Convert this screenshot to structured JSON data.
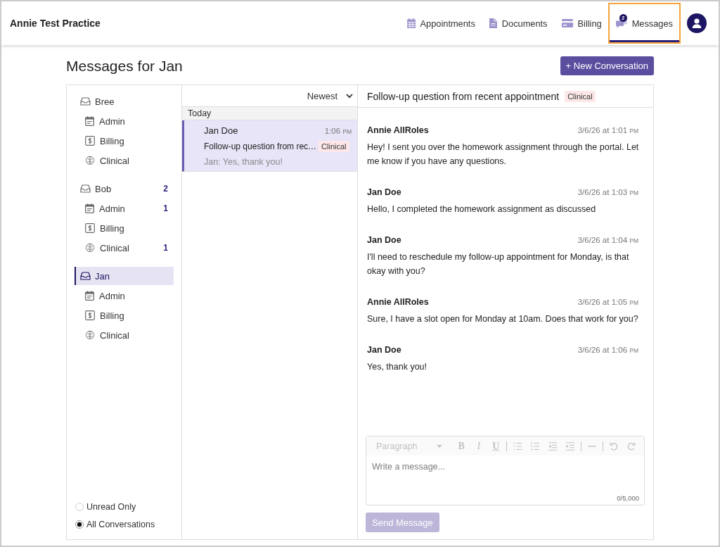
{
  "header": {
    "brand": "Annie Test Practice",
    "nav": [
      {
        "label": "Appointments",
        "kind": "calendar",
        "selected": false,
        "focused": false
      },
      {
        "label": "Documents",
        "kind": "document",
        "selected": false,
        "focused": false
      },
      {
        "label": "Billing",
        "kind": "card",
        "selected": false,
        "focused": false
      },
      {
        "label": "Messages",
        "kind": "chat",
        "badge": "2",
        "selected": true,
        "focused": true
      }
    ]
  },
  "page": {
    "title": "Messages for Jan",
    "new_button": "+ New Conversation"
  },
  "sidebar": {
    "groups": [
      {
        "label": "Bree",
        "selected": false,
        "children": [
          {
            "label": "Admin",
            "kind": "calendar",
            "selected": false
          },
          {
            "label": "Billing",
            "kind": "dollar",
            "selected": false
          },
          {
            "label": "Clinical",
            "kind": "brain",
            "selected": false
          }
        ]
      },
      {
        "label": "Bob",
        "count": "2",
        "selected": false,
        "children": [
          {
            "label": "Admin",
            "kind": "calendar",
            "count": "1",
            "selected": false
          },
          {
            "label": "Billing",
            "kind": "dollar",
            "selected": false
          },
          {
            "label": "Clinical",
            "kind": "brain",
            "count": "1",
            "selected": false
          }
        ]
      },
      {
        "label": "Jan",
        "selected": true,
        "children": [
          {
            "label": "Admin",
            "kind": "calendar",
            "selected": false
          },
          {
            "label": "Billing",
            "kind": "dollar",
            "selected": false
          },
          {
            "label": "Clinical",
            "kind": "brain",
            "selected": false
          }
        ]
      }
    ],
    "filters": [
      {
        "label": "Unread Only",
        "selected": false
      },
      {
        "label": "All Conversations",
        "selected": true
      }
    ]
  },
  "conversations": {
    "sort": "Newest",
    "sections": [
      {
        "heading": "Today",
        "items": [
          {
            "name": "Jan Doe",
            "time": "1:06",
            "meridiem": "PM",
            "subject": "Follow-up question from rec…",
            "tag": "Clinical",
            "preview": "Jan: Yes, thank you!",
            "selected": true
          }
        ]
      }
    ]
  },
  "thread": {
    "subject": "Follow-up question from recent appointment",
    "tag": "Clinical",
    "messages": [
      {
        "author": "Annie AllRoles",
        "time": "3/6/26 at 1:01",
        "meridiem": "PM",
        "body": "Hey! I sent you over the homework assignment through the portal. Let me know if you have any questions."
      },
      {
        "author": "Jan Doe",
        "time": "3/6/26 at 1:03",
        "meridiem": "PM",
        "body": "Hello, I completed the homework assignment as discussed"
      },
      {
        "author": "Jan Doe",
        "time": "3/6/26 at 1:04",
        "meridiem": "PM",
        "body": "I'll need to reschedule my follow-up appointment for Monday, is that okay with you?"
      },
      {
        "author": "Annie AllRoles",
        "time": "3/6/26 at 1:05",
        "meridiem": "PM",
        "body": "Sure, I have a slot open for Monday at 10am. Does that work for you?"
      },
      {
        "author": "Jan Doe",
        "time": "3/6/26 at 1:06",
        "meridiem": "PM",
        "body": "Yes, thank you!"
      }
    ]
  },
  "composer": {
    "toolbar": {
      "disabled": true,
      "items": [
        {
          "kind": "select",
          "label": "Paragraph"
        },
        {
          "kind": "bold",
          "label": "B"
        },
        {
          "kind": "italic",
          "label": "I"
        },
        {
          "kind": "underline",
          "label": "U"
        },
        {
          "kind": "separator"
        },
        {
          "kind": "numbered-list"
        },
        {
          "kind": "bullet-list"
        },
        {
          "kind": "outdent"
        },
        {
          "kind": "indent"
        },
        {
          "kind": "separator"
        },
        {
          "kind": "horizontal-rule"
        },
        {
          "kind": "separator"
        },
        {
          "kind": "undo"
        },
        {
          "kind": "redo"
        }
      ]
    },
    "placeholder": "Write a message...",
    "counter": "0/5,000",
    "send": {
      "label": "Send Message",
      "disabled": true
    }
  }
}
